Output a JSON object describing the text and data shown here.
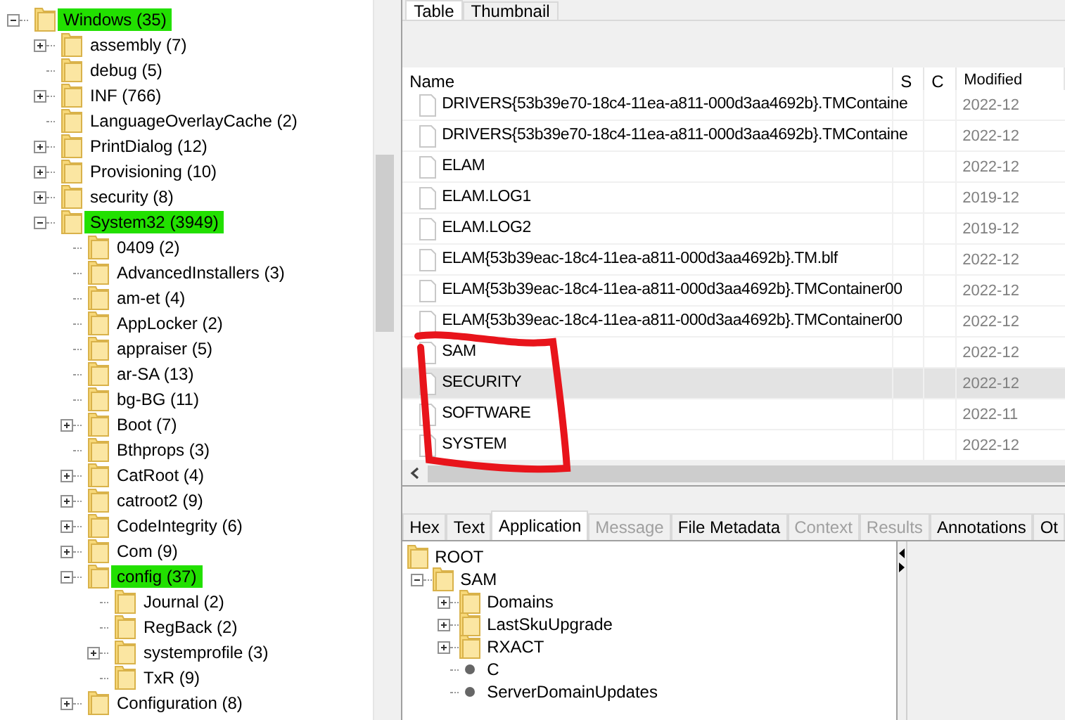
{
  "tree": [
    {
      "label": "Windows (35)",
      "highlighted": true,
      "kind": "branch",
      "expanded": true,
      "children": [
        {
          "label": "assembly (7)",
          "highlighted": false,
          "kind": "branch",
          "expanded": false
        },
        {
          "label": "debug (5)",
          "highlighted": false,
          "kind": "leaf"
        },
        {
          "label": "INF (766)",
          "highlighted": false,
          "kind": "branch",
          "expanded": false
        },
        {
          "label": "LanguageOverlayCache (2)",
          "highlighted": false,
          "kind": "leaf"
        },
        {
          "label": "PrintDialog (12)",
          "highlighted": false,
          "kind": "branch",
          "expanded": false
        },
        {
          "label": "Provisioning (10)",
          "highlighted": false,
          "kind": "branch",
          "expanded": false
        },
        {
          "label": "security (8)",
          "highlighted": false,
          "kind": "branch",
          "expanded": false
        },
        {
          "label": "System32 (3949)",
          "highlighted": true,
          "kind": "branch",
          "expanded": true,
          "children": [
            {
              "label": "0409 (2)",
              "highlighted": false,
              "kind": "leaf"
            },
            {
              "label": "AdvancedInstallers (3)",
              "highlighted": false,
              "kind": "leaf"
            },
            {
              "label": "am-et (4)",
              "highlighted": false,
              "kind": "leaf"
            },
            {
              "label": "AppLocker (2)",
              "highlighted": false,
              "kind": "leaf"
            },
            {
              "label": "appraiser (5)",
              "highlighted": false,
              "kind": "leaf"
            },
            {
              "label": "ar-SA (13)",
              "highlighted": false,
              "kind": "leaf"
            },
            {
              "label": "bg-BG (11)",
              "highlighted": false,
              "kind": "leaf"
            },
            {
              "label": "Boot (7)",
              "highlighted": false,
              "kind": "branch",
              "expanded": false
            },
            {
              "label": "Bthprops (3)",
              "highlighted": false,
              "kind": "leaf"
            },
            {
              "label": "CatRoot (4)",
              "highlighted": false,
              "kind": "branch",
              "expanded": false
            },
            {
              "label": "catroot2 (9)",
              "highlighted": false,
              "kind": "branch",
              "expanded": false
            },
            {
              "label": "CodeIntegrity (6)",
              "highlighted": false,
              "kind": "branch",
              "expanded": false
            },
            {
              "label": "Com (9)",
              "highlighted": false,
              "kind": "branch",
              "expanded": false
            },
            {
              "label": "config (37)",
              "highlighted": true,
              "kind": "branch",
              "expanded": true,
              "children": [
                {
                  "label": "Journal (2)",
                  "highlighted": false,
                  "kind": "leaf"
                },
                {
                  "label": "RegBack (2)",
                  "highlighted": false,
                  "kind": "leaf"
                },
                {
                  "label": "systemprofile (3)",
                  "highlighted": false,
                  "kind": "branch",
                  "expanded": false
                },
                {
                  "label": "TxR (9)",
                  "highlighted": false,
                  "kind": "leaf"
                }
              ]
            },
            {
              "label": "Configuration (8)",
              "highlighted": false,
              "kind": "branch",
              "expanded": false
            }
          ]
        }
      ]
    }
  ],
  "table_tabs": [
    {
      "label": "Table",
      "selected": true
    },
    {
      "label": "Thumbnail",
      "selected": false
    }
  ],
  "table": {
    "columns": [
      "Name",
      "S",
      "C",
      "Modified"
    ],
    "rows": [
      {
        "name": "DRIVERS{53b39e70-18c4-11ea-a811-000d3aa4692b}.TMContaine",
        "modified": "2022-12",
        "selected": false
      },
      {
        "name": "DRIVERS{53b39e70-18c4-11ea-a811-000d3aa4692b}.TMContaine",
        "modified": "2022-12",
        "selected": false
      },
      {
        "name": "ELAM",
        "modified": "2022-12",
        "selected": false
      },
      {
        "name": "ELAM.LOG1",
        "modified": "2019-12",
        "selected": false
      },
      {
        "name": "ELAM.LOG2",
        "modified": "2019-12",
        "selected": false
      },
      {
        "name": "ELAM{53b39eac-18c4-11ea-a811-000d3aa4692b}.TM.blf",
        "modified": "2022-12",
        "selected": false
      },
      {
        "name": "ELAM{53b39eac-18c4-11ea-a811-000d3aa4692b}.TMContainer00",
        "modified": "2022-12",
        "selected": false
      },
      {
        "name": "ELAM{53b39eac-18c4-11ea-a811-000d3aa4692b}.TMContainer00",
        "modified": "2022-12",
        "selected": false
      },
      {
        "name": "SAM",
        "modified": "2022-12",
        "selected": false
      },
      {
        "name": "SECURITY",
        "modified": "2022-12",
        "selected": true
      },
      {
        "name": "SOFTWARE",
        "modified": "2022-11",
        "selected": false
      },
      {
        "name": "SYSTEM",
        "modified": "2022-12",
        "selected": false
      }
    ]
  },
  "viewer_tabs": [
    {
      "label": "Hex",
      "selected": false,
      "disabled": false
    },
    {
      "label": "Text",
      "selected": false,
      "disabled": false
    },
    {
      "label": "Application",
      "selected": true,
      "disabled": false
    },
    {
      "label": "Message",
      "selected": false,
      "disabled": true
    },
    {
      "label": "File Metadata",
      "selected": false,
      "disabled": false
    },
    {
      "label": "Context",
      "selected": false,
      "disabled": true
    },
    {
      "label": "Results",
      "selected": false,
      "disabled": true
    },
    {
      "label": "Annotations",
      "selected": false,
      "disabled": false
    },
    {
      "label": "Ot",
      "selected": false,
      "disabled": false
    }
  ],
  "app_tree": [
    {
      "label": "ROOT",
      "kind": "root",
      "children": [
        {
          "label": "SAM",
          "kind": "key",
          "expanded": true,
          "children": [
            {
              "label": "Domains",
              "kind": "key",
              "expanded": false
            },
            {
              "label": "LastSkuUpgrade",
              "kind": "key",
              "expanded": false
            },
            {
              "label": "RXACT",
              "kind": "key",
              "expanded": false
            },
            {
              "label": "C",
              "kind": "value"
            },
            {
              "label": "ServerDomainUpdates",
              "kind": "value"
            }
          ]
        }
      ]
    }
  ]
}
